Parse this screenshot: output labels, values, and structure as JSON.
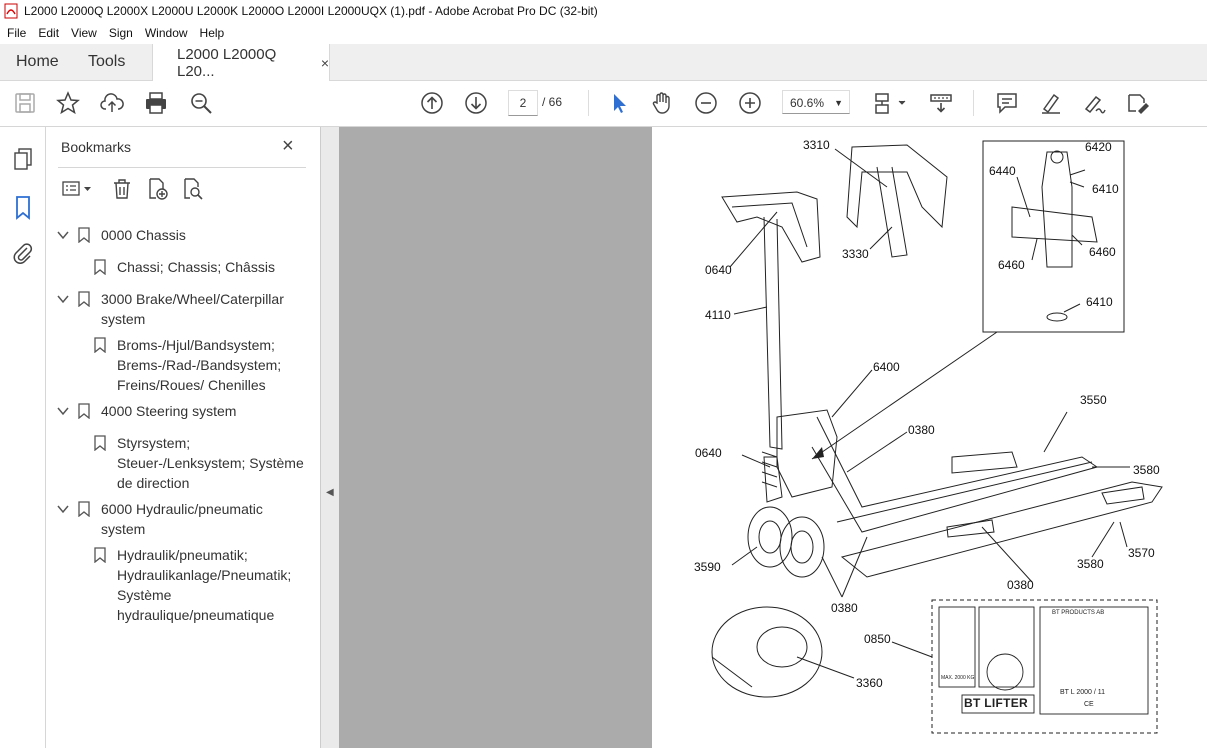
{
  "window": {
    "title": "L2000 L2000Q L2000X L2000U L2000K L2000O L2000I L2000UQX (1).pdf - Adobe Acrobat Pro DC (32-bit)"
  },
  "menu": [
    "File",
    "Edit",
    "View",
    "Sign",
    "Window",
    "Help"
  ],
  "tabs": {
    "home": "Home",
    "tools": "Tools",
    "document": "L2000 L2000Q L20...",
    "close": "×"
  },
  "toolbar": {
    "left_icons": [
      "save-icon",
      "bookmark-star-icon",
      "upload-icon",
      "print-icon",
      "search-zoom-icon"
    ],
    "page_current": "2",
    "page_total": "/ 66",
    "zoom": "60.6%",
    "right_icons": [
      "select-arrow-icon",
      "hand-icon",
      "zoom-out-icon",
      "zoom-in-icon",
      "page-fit-icon",
      "keyboard-icon",
      "comment-icon",
      "highlight-icon",
      "sign-icon",
      "redact-icon"
    ]
  },
  "bookmarks": {
    "title": "Bookmarks",
    "close": "×",
    "items": [
      {
        "label": "0000 Chassis",
        "level": 0
      },
      {
        "label": "Chassi; Chassis; Châssis",
        "level": 1
      },
      {
        "label": "3000 Brake/Wheel/Caterpillar system",
        "level": 0
      },
      {
        "label": "Broms-/Hjul/Bandsystem; Brems-/Rad-/Bandsystem; Freins/Roues/ Chenilles",
        "level": 1
      },
      {
        "label": "4000 Steering system",
        "level": 0
      },
      {
        "label": "Styrsystem; Steuer-/Lenksystem; Système de direction",
        "level": 1
      },
      {
        "label": "6000 Hydraulic/pneumatic system",
        "level": 0
      },
      {
        "label": "Hydraulik/pneumatik; Hydraulikanlage/Pneumatik; Système hydraulique/pneumatique",
        "level": 1
      }
    ]
  },
  "drawing": {
    "labels": [
      "3310",
      "3330",
      "0640",
      "4110",
      "6420",
      "6440",
      "6410",
      "6460",
      "6460",
      "6410",
      "6400",
      "3550",
      "0380",
      "3580",
      "0640",
      "3590",
      "0380",
      "3580",
      "3570",
      "0380",
      "0850",
      "3360"
    ],
    "nameplate": {
      "brand": "BT LIFTER",
      "company": "BT PRODUCTS AB",
      "model": "BT L 2000 / 11",
      "max": "MAX. 2000 KG",
      "ce": "CE"
    }
  },
  "colors": {
    "accent": "#2d6fd2",
    "canvas": "#ababab"
  }
}
